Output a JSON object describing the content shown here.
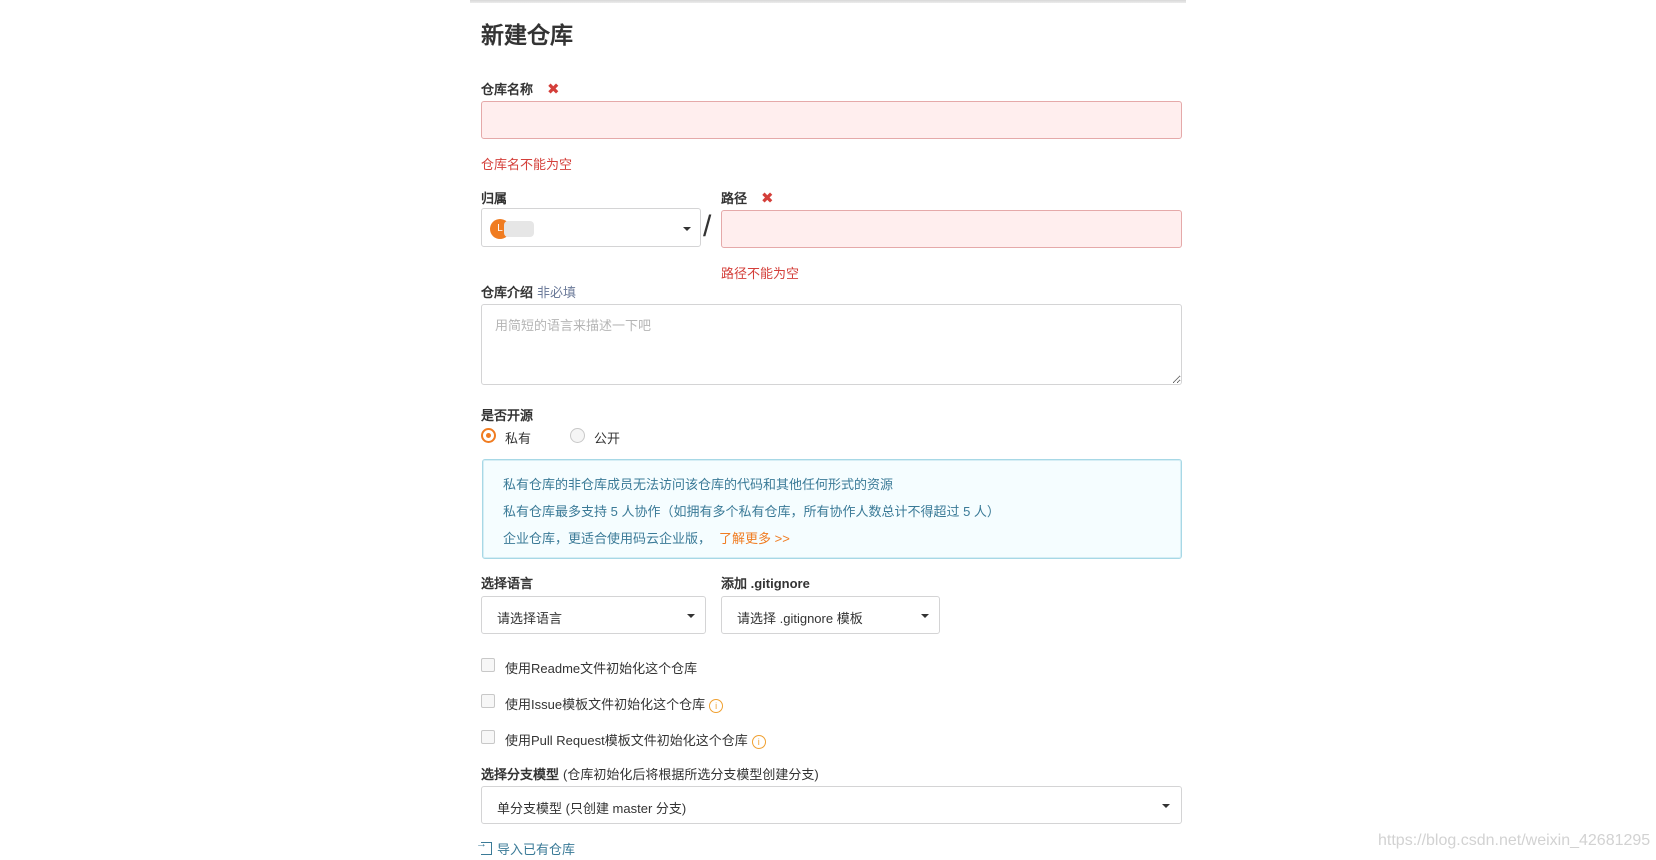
{
  "page": {
    "title": "新建仓库",
    "accent_color": "#f07c21",
    "error_color": "#d43f3a"
  },
  "repo_name": {
    "label": "仓库名称",
    "required_mark": "✖",
    "value": "",
    "error": "仓库名不能为空"
  },
  "owner": {
    "label": "归属",
    "avatar_initial": "L",
    "separator": "/"
  },
  "path": {
    "label": "路径",
    "required_mark": "✖",
    "value": "",
    "error": "路径不能为空"
  },
  "description": {
    "label": "仓库介绍",
    "optional_tag": "非必填",
    "placeholder": "用简短的语言来描述一下吧",
    "value": ""
  },
  "visibility": {
    "label": "是否开源",
    "options": [
      {
        "label": "私有",
        "selected": true
      },
      {
        "label": "公开",
        "selected": false
      }
    ]
  },
  "info_box": {
    "lines": [
      "私有仓库的非仓库成员无法访问该仓库的代码和其他任何形式的资源",
      "私有仓库最多支持 5 人协作（如拥有多个私有仓库，所有协作人数总计不得超过 5 人）",
      "企业仓库，更适合使用码云企业版，"
    ],
    "link": "了解更多 >>"
  },
  "language": {
    "label": "选择语言",
    "selected": "请选择语言"
  },
  "gitignore": {
    "label": "添加 .gitignore",
    "selected": "请选择 .gitignore 模板"
  },
  "init_options": [
    {
      "label": "使用Readme文件初始化这个仓库",
      "checked": false,
      "has_info": false
    },
    {
      "label": "使用Issue模板文件初始化这个仓库",
      "checked": false,
      "has_info": true
    },
    {
      "label": "使用Pull Request模板文件初始化这个仓库",
      "checked": false,
      "has_info": true
    }
  ],
  "branch_model": {
    "label": "选择分支模型",
    "hint": "(仓库初始化后将根据所选分支模型创建分支)",
    "selected": "单分支模型 (只创建 master 分支)"
  },
  "import_link": "导入已有仓库",
  "watermark": "https://blog.csdn.net/weixin_42681295",
  "icons": {
    "info": "info-circle-icon",
    "import": "import-icon",
    "caret": "caret-down-icon"
  }
}
